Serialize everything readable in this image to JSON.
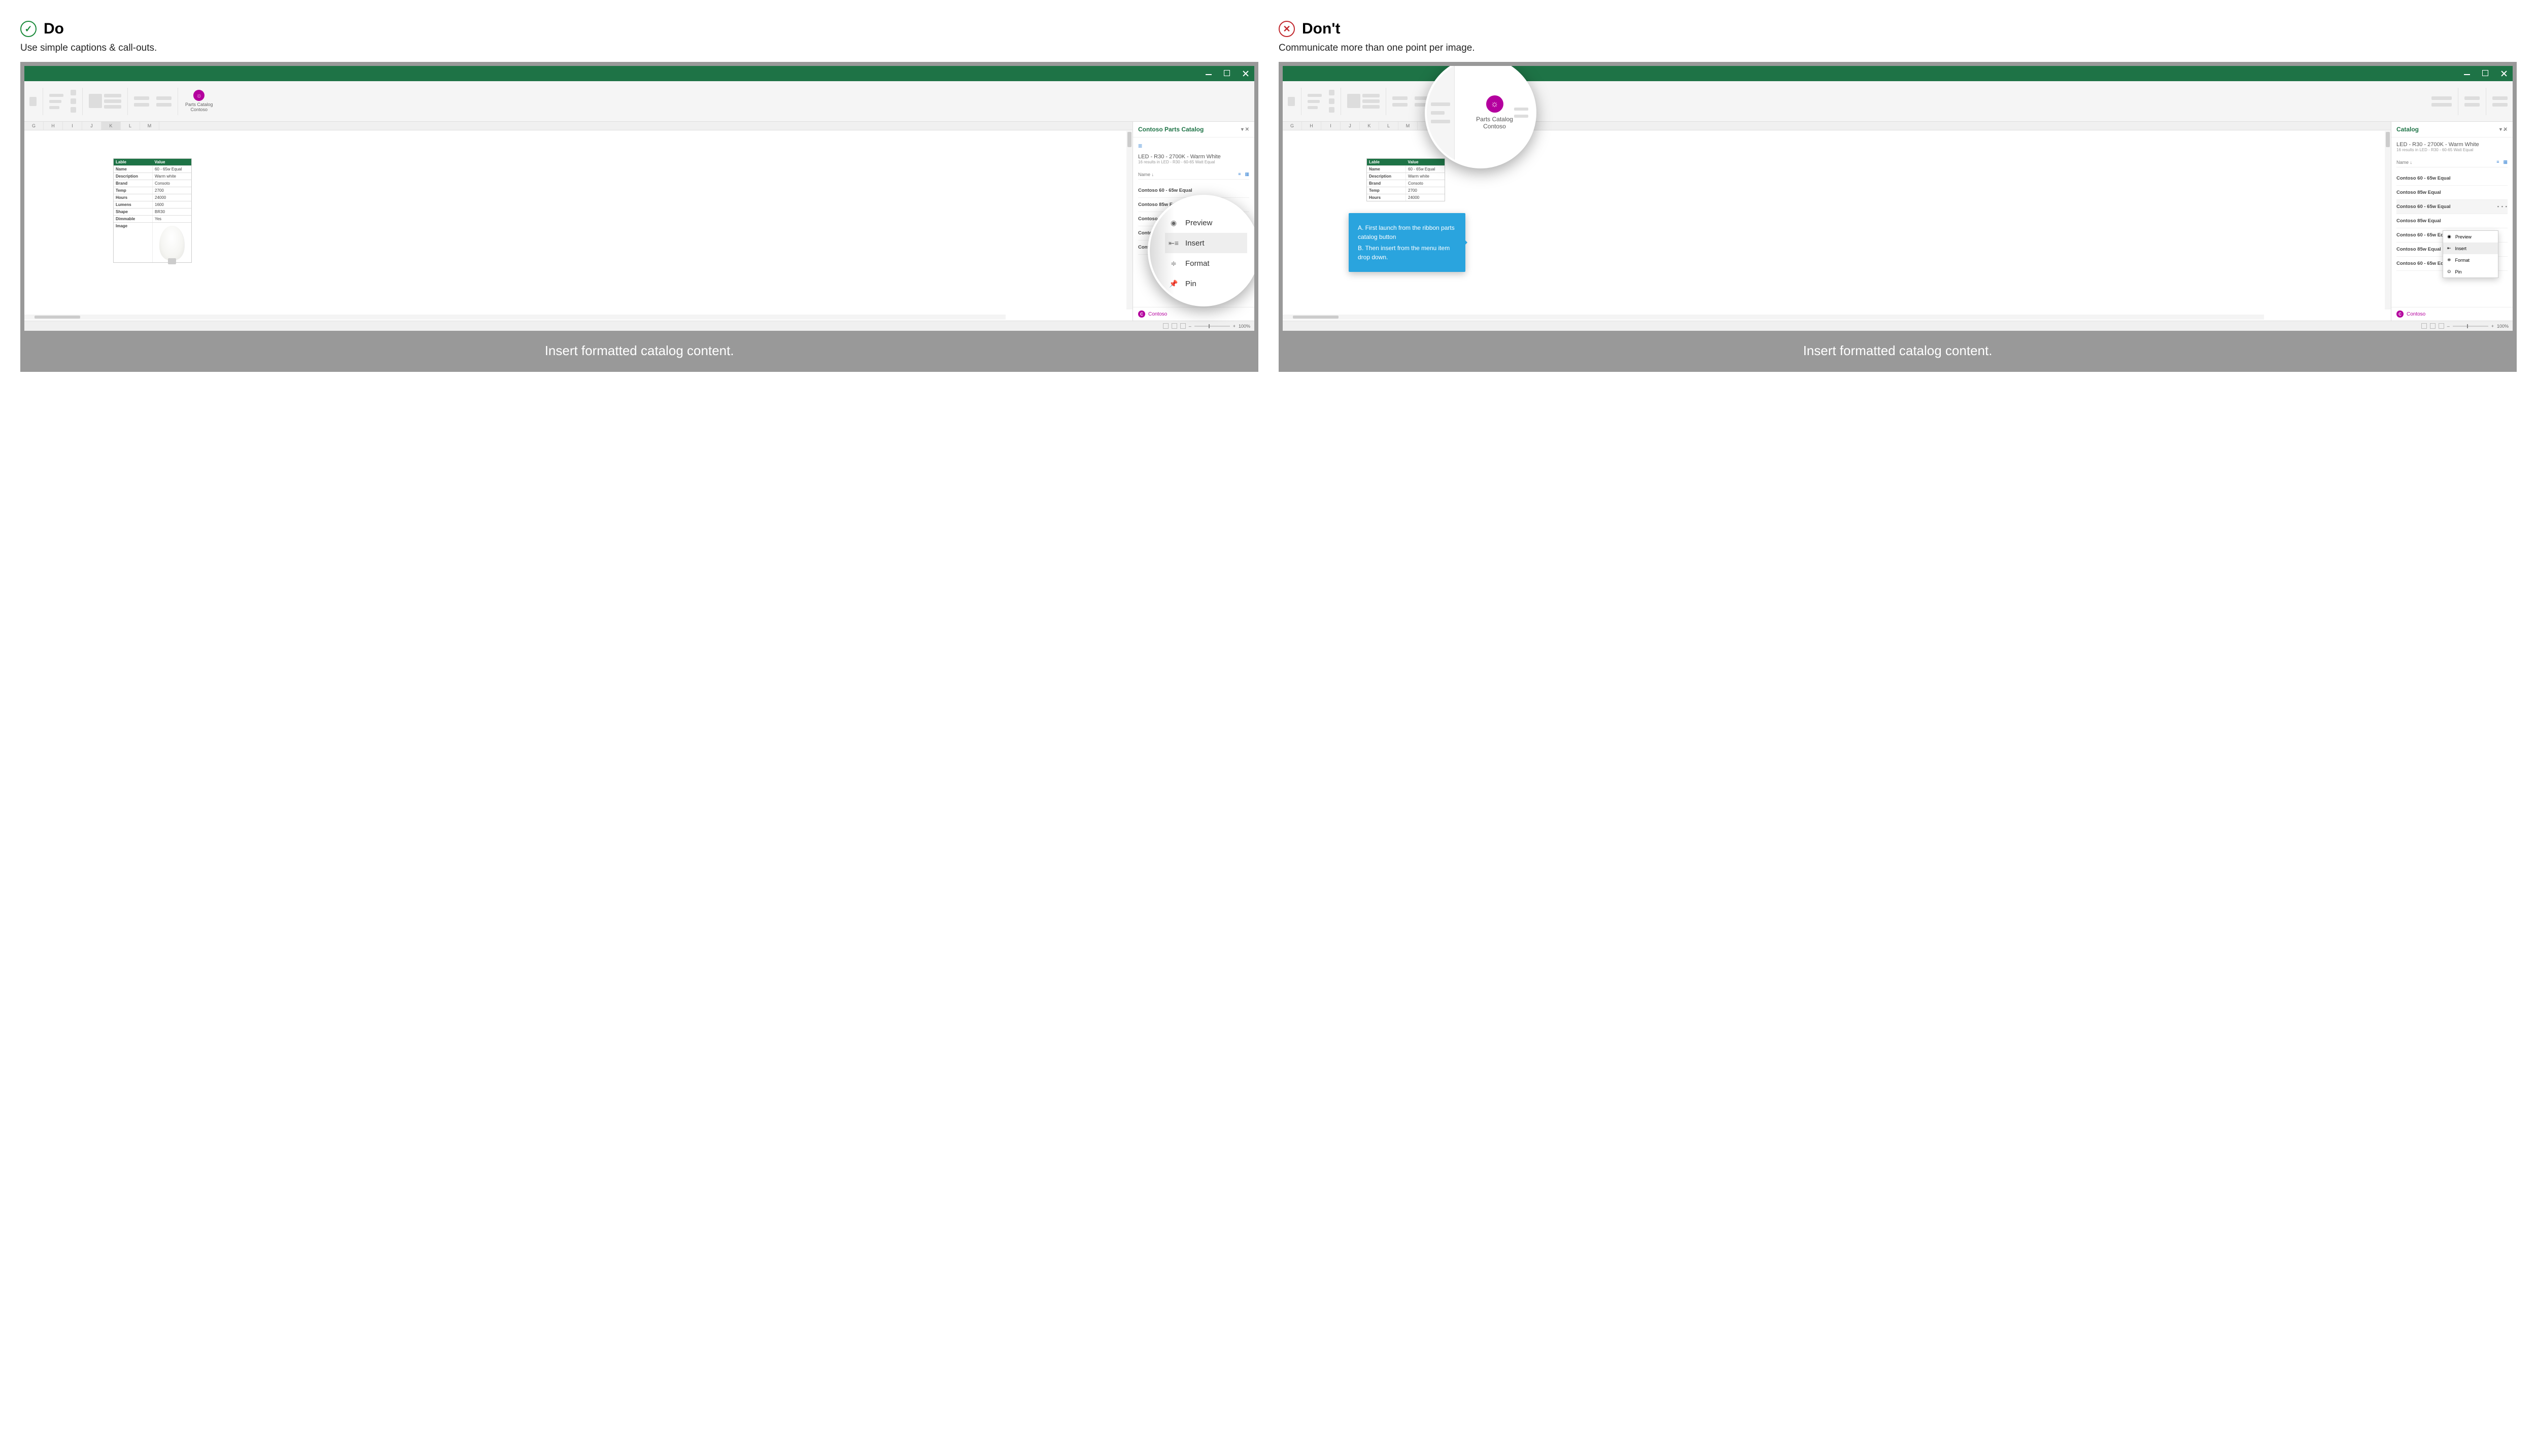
{
  "do": {
    "title": "Do",
    "subtitle": "Use simple captions & call-outs.",
    "caption": "Insert formatted catalog content."
  },
  "dont": {
    "title": "Don't",
    "subtitle": "Communicate more than one point per image.",
    "caption": "Insert formatted catalog content."
  },
  "addin": {
    "name_line1": "Parts Catalog",
    "name_line2": "Contoso"
  },
  "pane": {
    "title": "Contoso Parts Catalog",
    "heading": "LED - R30 - 2700K - Warm White",
    "sub": "16 results in LED - R30 - 60-65 Watt Equal",
    "sort": "Name",
    "footer": "Contoso"
  },
  "list": [
    "Contoso 60 - 65w Equal",
    "Contoso 85w Equal",
    "Contoso 60 - 65w Equal",
    "Contoso 85w Equal",
    "Contoso 60 - 65w Equal",
    "Contoso 85w Equal",
    "Contoso 60 - 65w Equal"
  ],
  "cols": [
    "G",
    "H",
    "I",
    "J",
    "K",
    "L",
    "M"
  ],
  "table": {
    "headers": [
      "Lable",
      "Value"
    ],
    "rows": [
      [
        "Name",
        "60 - 65w Equal"
      ],
      [
        "Description",
        "Warm white"
      ],
      [
        "Brand",
        "Consoto"
      ],
      [
        "Temp",
        "2700"
      ],
      [
        "Hours",
        "24000"
      ],
      [
        "Lumens",
        "1600"
      ],
      [
        "Shape",
        "BR30"
      ],
      [
        "Dimmable",
        "Yes"
      ],
      [
        "Image",
        ""
      ]
    ]
  },
  "menu": {
    "preview": "Preview",
    "insert": "Insert",
    "format": "Format",
    "pin": "Pin"
  },
  "callout": {
    "a": "A.  First launch from the ribbon parts catalog button",
    "b": "B.  Then insert from the menu item drop down."
  },
  "mag_addin": {
    "line1": "Parts Catalog",
    "line2": "Contoso"
  },
  "status": {
    "zoom": "100%"
  }
}
